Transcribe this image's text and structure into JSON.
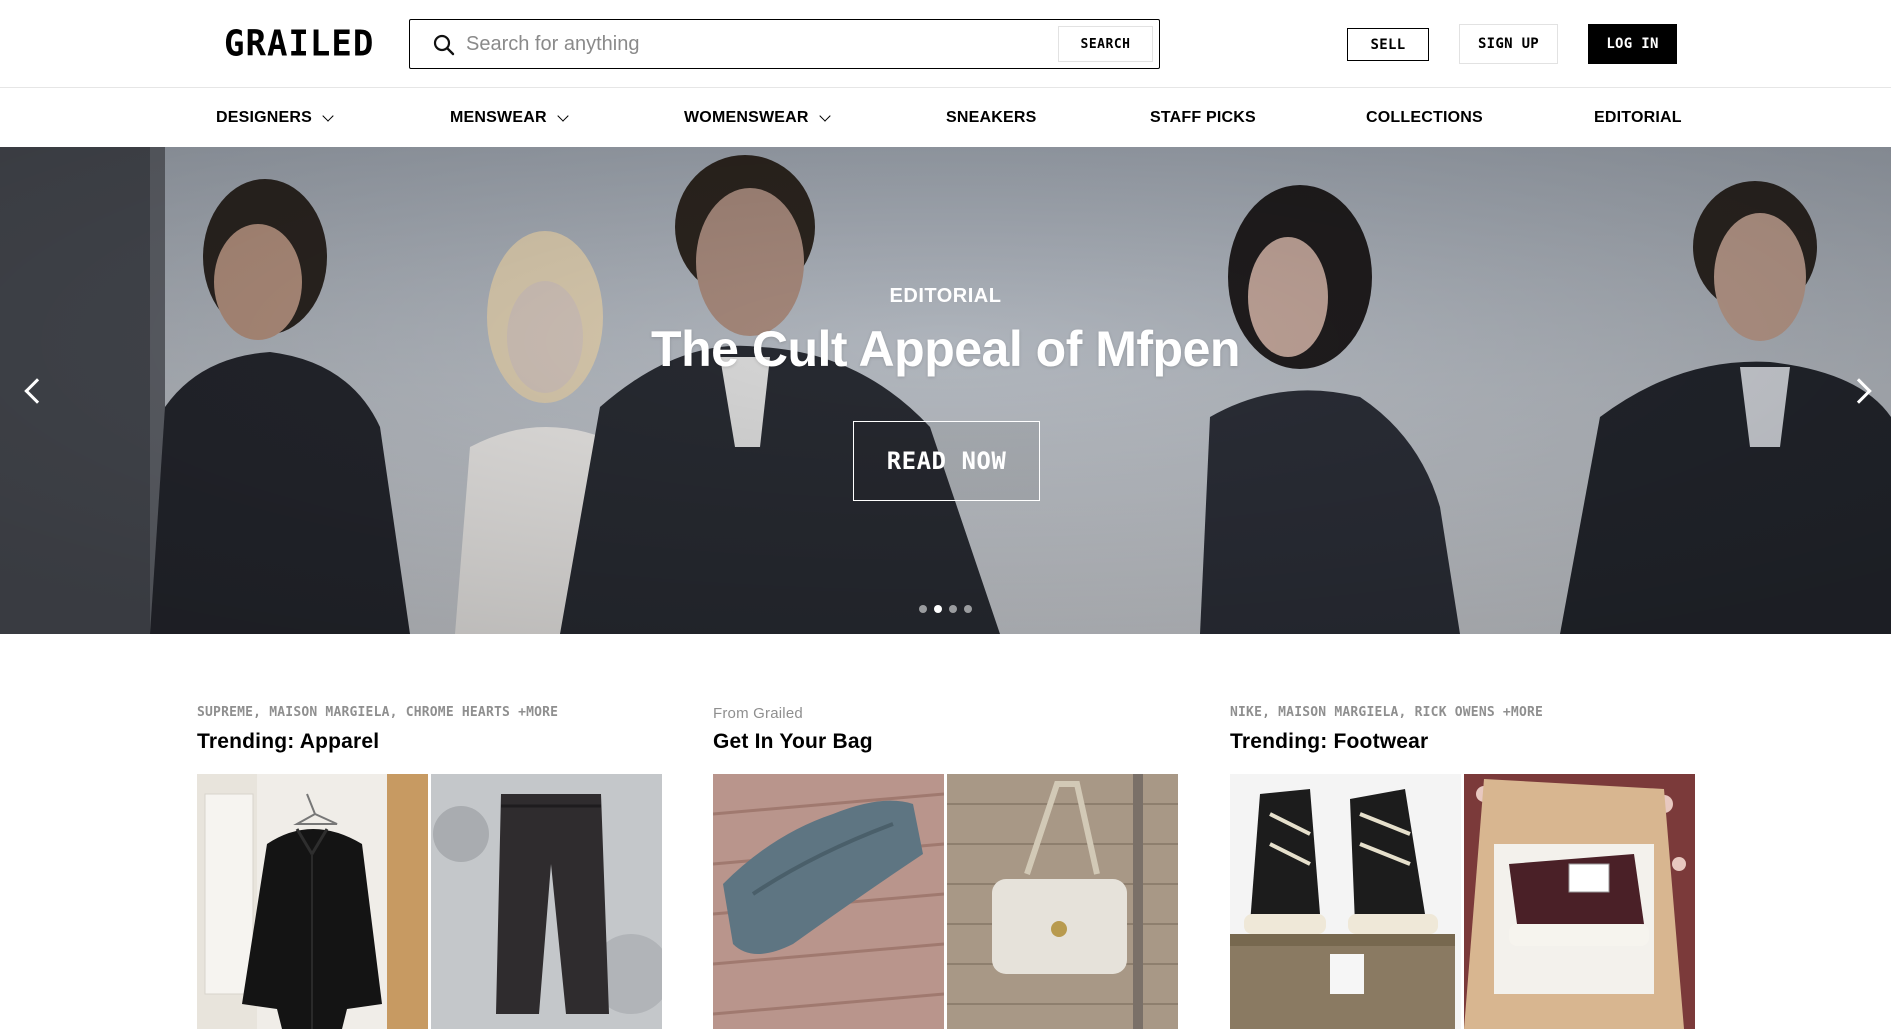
{
  "header": {
    "logo": "GRAILED",
    "search": {
      "placeholder": "Search for anything",
      "button_label": "SEARCH",
      "icon": "search-icon"
    },
    "sell_label": "SELL",
    "signup_label": "SIGN UP",
    "login_label": "LOG IN"
  },
  "nav": {
    "items": [
      {
        "label": "DESIGNERS",
        "has_dropdown": true
      },
      {
        "label": "MENSWEAR",
        "has_dropdown": true
      },
      {
        "label": "WOMENSWEAR",
        "has_dropdown": true
      },
      {
        "label": "SNEAKERS",
        "has_dropdown": false
      },
      {
        "label": "STAFF PICKS",
        "has_dropdown": false
      },
      {
        "label": "COLLECTIONS",
        "has_dropdown": false
      },
      {
        "label": "EDITORIAL",
        "has_dropdown": false
      }
    ]
  },
  "hero": {
    "kicker": "EDITORIAL",
    "title": "The Cult Appeal of Mfpen",
    "cta_label": "READ NOW",
    "slides_total": 4,
    "active_slide": 2,
    "prev_icon": "chevron-left-icon",
    "next_icon": "chevron-right-icon"
  },
  "collections": [
    {
      "kicker": "SUPREME, MAISON MARGIELA, CHROME HEARTS +MORE",
      "title": "Trending: Apparel"
    },
    {
      "kicker": "From Grailed",
      "title": "Get In Your Bag"
    },
    {
      "kicker": "NIKE, MAISON MARGIELA, RICK OWENS +MORE",
      "title": "Trending: Footwear"
    }
  ],
  "colors": {
    "accent": "#000000",
    "hero_wall": "#a9aeb6",
    "muted_text": "#8f8f8f"
  }
}
